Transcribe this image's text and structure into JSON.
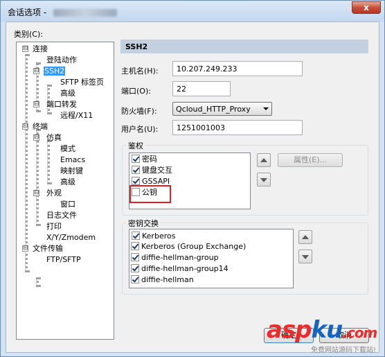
{
  "window": {
    "title": "会话选项 - ",
    "close": "x"
  },
  "category_label": "类别(C):",
  "tree": [
    {
      "label": "连接"
    },
    {
      "label": "登陆动作"
    },
    {
      "label": "SSH2"
    },
    {
      "label": "SFTP 标签页"
    },
    {
      "label": "高级"
    },
    {
      "label": "端口转发"
    },
    {
      "label": "远程/X11"
    },
    {
      "label": "终端"
    },
    {
      "label": "仿真"
    },
    {
      "label": "模式"
    },
    {
      "label": "Emacs"
    },
    {
      "label": "映射键"
    },
    {
      "label": "高级"
    },
    {
      "label": "外观"
    },
    {
      "label": "窗口"
    },
    {
      "label": "日志文件"
    },
    {
      "label": "打印"
    },
    {
      "label": "X/Y/Zmodem"
    },
    {
      "label": "文件传输"
    },
    {
      "label": "FTP/SFTP"
    }
  ],
  "tree_expanders": [
    "⊟",
    "⊟",
    "⊟",
    "⊟",
    "⊟",
    "⊟",
    "⊟"
  ],
  "panel": {
    "header": "SSH2",
    "hostname_label": "主机名(H):",
    "hostname_value": "10.207.249.233",
    "port_label": "端口(O):",
    "port_value": "22",
    "firewall_label": "防火墙(F):",
    "firewall_value": "Qcloud_HTTP_Proxy",
    "username_label": "用户名(U):",
    "username_value": "1251001003"
  },
  "auth": {
    "group_title": "鉴权",
    "items": [
      {
        "label": "密码",
        "checked": true
      },
      {
        "label": "键盘交互",
        "checked": true
      },
      {
        "label": "GSSAPI",
        "checked": true
      },
      {
        "label": "公钥",
        "checked": false
      }
    ],
    "properties_button": "属性(E)..."
  },
  "kex": {
    "group_title": "密钥交换",
    "items": [
      {
        "label": "Kerberos",
        "checked": true
      },
      {
        "label": "Kerberos (Group Exchange)",
        "checked": true
      },
      {
        "label": "diffie-hellman-group",
        "checked": true
      },
      {
        "label": "diffie-hellman-group14",
        "checked": true
      },
      {
        "label": "diffie-hellman",
        "checked": true
      }
    ]
  },
  "footer": {
    "ok_button": "确定",
    "cancel_button": "取消"
  },
  "watermark": {
    "brand_a": "asp",
    "brand_b": "ku",
    "brand_c": ".com",
    "subtitle": "免费网站源码下载站!"
  }
}
